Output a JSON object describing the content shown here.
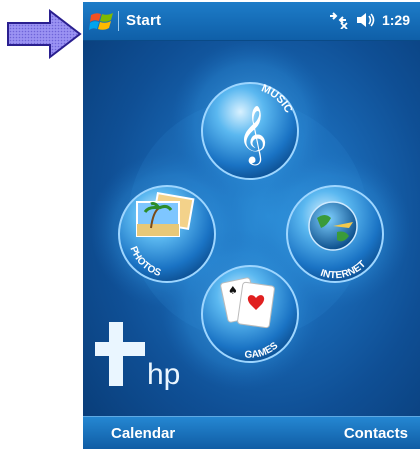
{
  "title_bar": {
    "start_label": "Start",
    "time": "1:29"
  },
  "menu": {
    "music_label": "MUSIC",
    "photos_label": "PHOTOS",
    "internet_label": "INTERNET",
    "games_label": "GAMES"
  },
  "brand": {
    "hp_text": "hp"
  },
  "softkeys": {
    "left": "Calendar",
    "right": "Contacts"
  },
  "icons": {
    "pointer": "arrow-right-icon",
    "start": "windows-flag-icon",
    "connectivity": "connectivity-icon",
    "volume": "volume-icon"
  },
  "colors": {
    "title_bar": "#1d7cc8",
    "background": "#0f4f95",
    "pointer_fill": "#8f86f0"
  }
}
